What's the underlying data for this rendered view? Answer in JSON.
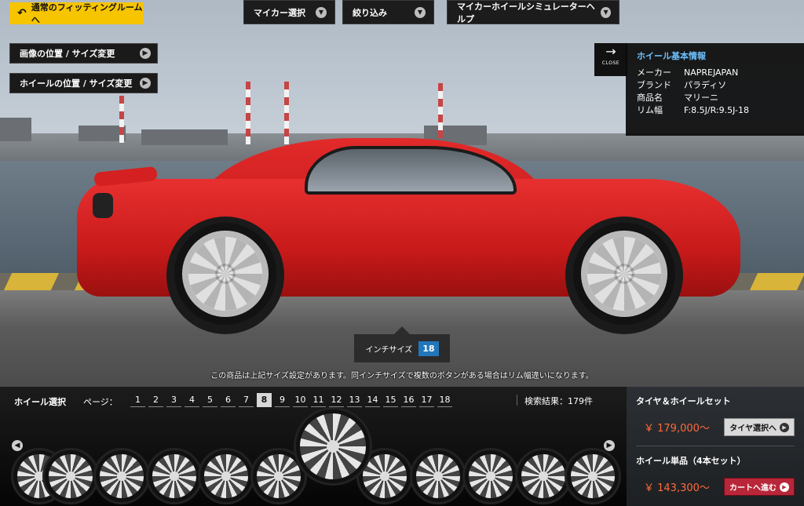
{
  "top": {
    "back_label": "通常のフィッティングルームへ",
    "menus": [
      "マイカー選択",
      "絞り込み",
      "マイカーホイールシミュレーターヘルプ"
    ],
    "side_buttons": [
      "画像の位置 / サイズ変更",
      "ホイールの位置 / サイズ変更"
    ]
  },
  "info": {
    "close_label": "CLOSE",
    "title": "ホイール基本情報",
    "rows": [
      {
        "k": "メーカー",
        "v": "NAPREJAPAN"
      },
      {
        "k": "ブランド",
        "v": "パラディソ"
      },
      {
        "k": "商品名",
        "v": "マリーニ"
      },
      {
        "k": "リム幅",
        "v": "F:8.5J/R:9.5J-18"
      }
    ]
  },
  "inch": {
    "label": "インチサイズ",
    "value": "18"
  },
  "notice": "この商品は上記サイズ設定があります。同インチサイズで複数のボタンがある場合はリム幅違いになります。",
  "selector": {
    "label": "ホイール選択",
    "page_label": "ページ：",
    "pages": [
      "1",
      "2",
      "3",
      "4",
      "5",
      "6",
      "7",
      "8",
      "9",
      "10",
      "11",
      "12",
      "13",
      "14",
      "15",
      "16",
      "17",
      "18"
    ],
    "active_page": "8",
    "results": "検索結果：179件"
  },
  "cart": {
    "set_title": "タイヤ＆ホイールセット",
    "set_price": "￥ 179,000〜",
    "set_button": "タイヤ選択へ",
    "single_title": "ホイール単品（4本セット）",
    "single_price": "￥ 143,300〜",
    "single_button": "カートへ進む"
  },
  "colors": {
    "accent_yellow": "#f7c400",
    "price": "#ff6a3d",
    "cart_button": "#b8263a",
    "inch_badge": "#2277bb",
    "info_title": "#6ec3ff"
  }
}
